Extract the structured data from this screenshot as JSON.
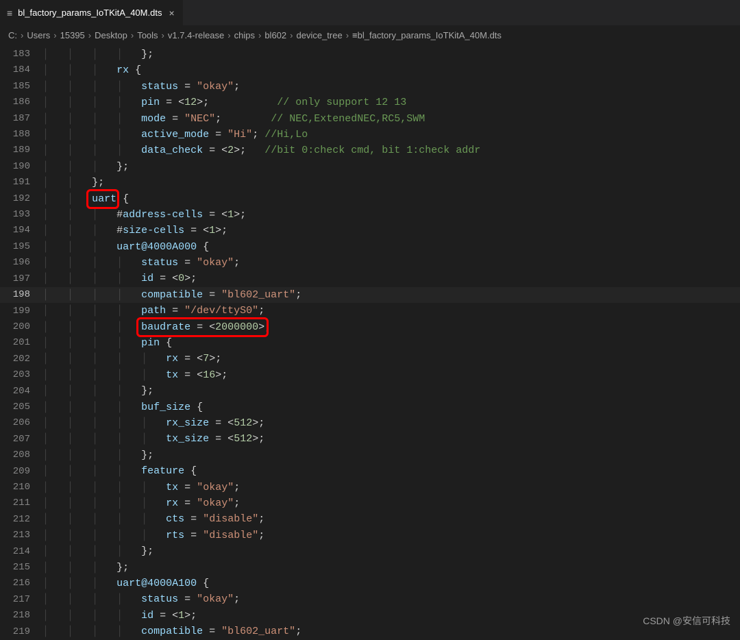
{
  "tab": {
    "label": "bl_factory_params_IoTKitA_40M.dts",
    "close": "×",
    "icon": "≡"
  },
  "breadcrumbs": [
    "C:",
    "Users",
    "15395",
    "Desktop",
    "Tools",
    "v1.7.4-release",
    "chips",
    "bl602",
    "device_tree",
    "bl_factory_params_IoTKitA_40M.dts"
  ],
  "bc_icon": "≡",
  "bc_sep": "›",
  "line_start": 183,
  "line_end": 219,
  "current_line": 198,
  "highlights": [
    {
      "name": "uart-highlight",
      "line": 192,
      "col_ch_start": 4,
      "col_ch_end": 8.8
    },
    {
      "name": "baudrate-highlight",
      "line": 200,
      "col_ch_start": 12,
      "col_ch_end": 34.8
    }
  ],
  "code": {
    "l183": {
      "ind": 4,
      "open": "};"
    },
    "l184": {
      "ind": 3,
      "id": "rx",
      "brace": " {"
    },
    "l185": {
      "ind": 4,
      "id": "status",
      "assign": " = ",
      "str": "\"okay\"",
      "end": ";"
    },
    "l186": {
      "ind": 4,
      "id": "pin",
      "assign": " = <",
      "num": "12",
      "end_tail": ">;",
      "pad": "           ",
      "cmt": "// only support 12 13"
    },
    "l187": {
      "ind": 4,
      "id": "mode",
      "assign": " = ",
      "str": "\"NEC\"",
      "end": ";",
      "pad": "        ",
      "cmt": "// NEC,ExtenedNEC,RC5,SWM"
    },
    "l188": {
      "ind": 4,
      "id": "active_mode",
      "assign": " = ",
      "str": "\"Hi\"",
      "end": "; ",
      "cmt": "//Hi,Lo"
    },
    "l189": {
      "ind": 4,
      "id": "data_check",
      "assign": " = <",
      "num": "2",
      "end_tail": ">;   ",
      "cmt": "//bit 0:check cmd, bit 1:check addr"
    },
    "l190": {
      "ind": 3,
      "open": "};"
    },
    "l191": {
      "ind": 2,
      "open": "};"
    },
    "l192": {
      "ind": 2,
      "id": "uart",
      "brace": " {"
    },
    "l193": {
      "ind": 3,
      "text_pre": "#",
      "id": "address-cells",
      "assign": " = <",
      "num": "1",
      "end_tail": ">;"
    },
    "l194": {
      "ind": 3,
      "text_pre": "#",
      "id": "size-cells",
      "assign": " = <",
      "num": "1",
      "end_tail": ">;"
    },
    "l195": {
      "ind": 3,
      "id": "uart@4000A000",
      "brace": " {"
    },
    "l196": {
      "ind": 4,
      "id": "status",
      "assign": " = ",
      "str": "\"okay\"",
      "end": ";"
    },
    "l197": {
      "ind": 4,
      "id": "id",
      "assign": " = <",
      "num": "0",
      "end_tail": ">;"
    },
    "l198": {
      "ind": 4,
      "id": "compatible",
      "assign": " = ",
      "str": "\"bl602_uart\"",
      "end": ";"
    },
    "l199": {
      "ind": 4,
      "id": "path",
      "assign": " = ",
      "str": "\"/dev/ttyS0\"",
      "end": ";"
    },
    "l200": {
      "ind": 4,
      "id": "baudrate",
      "assign": " = <",
      "num": "2000000",
      "end_tail": ">;"
    },
    "l201": {
      "ind": 4,
      "id": "pin",
      "brace": " {"
    },
    "l202": {
      "ind": 5,
      "id": "rx",
      "assign": " = <",
      "num": "7",
      "end_tail": ">;"
    },
    "l203": {
      "ind": 5,
      "id": "tx",
      "assign": " = <",
      "num": "16",
      "end_tail": ">;"
    },
    "l204": {
      "ind": 4,
      "open": "};"
    },
    "l205": {
      "ind": 4,
      "id": "buf_size",
      "brace": " {"
    },
    "l206": {
      "ind": 5,
      "id": "rx_size",
      "assign": " = <",
      "num": "512",
      "end_tail": ">;"
    },
    "l207": {
      "ind": 5,
      "id": "tx_size",
      "assign": " = <",
      "num": "512",
      "end_tail": ">;"
    },
    "l208": {
      "ind": 4,
      "open": "};"
    },
    "l209": {
      "ind": 4,
      "id": "feature",
      "brace": " {"
    },
    "l210": {
      "ind": 5,
      "id": "tx",
      "assign": " = ",
      "str": "\"okay\"",
      "end": ";"
    },
    "l211": {
      "ind": 5,
      "id": "rx",
      "assign": " = ",
      "str": "\"okay\"",
      "end": ";"
    },
    "l212": {
      "ind": 5,
      "id": "cts",
      "assign": " = ",
      "str": "\"disable\"",
      "end": ";"
    },
    "l213": {
      "ind": 5,
      "id": "rts",
      "assign": " = ",
      "str": "\"disable\"",
      "end": ";"
    },
    "l214": {
      "ind": 4,
      "open": "};"
    },
    "l215": {
      "ind": 3,
      "open": "};"
    },
    "l216": {
      "ind": 3,
      "id": "uart@4000A100",
      "brace": " {"
    },
    "l217": {
      "ind": 4,
      "id": "status",
      "assign": " = ",
      "str": "\"okay\"",
      "end": ";"
    },
    "l218": {
      "ind": 4,
      "id": "id",
      "assign": " = <",
      "num": "1",
      "end_tail": ">;"
    },
    "l219": {
      "ind": 4,
      "id": "compatible",
      "assign": " = ",
      "str": "\"bl602_uart\"",
      "end": ";"
    }
  },
  "watermark": "CSDN @安信可科技"
}
